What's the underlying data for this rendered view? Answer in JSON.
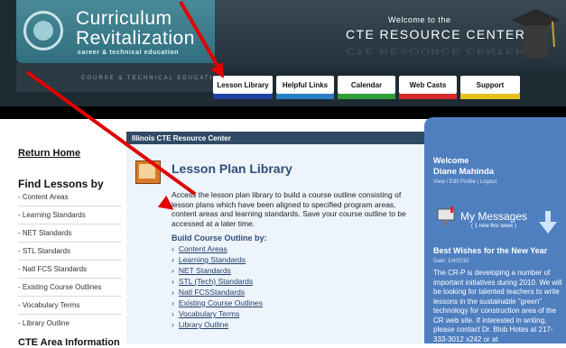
{
  "header": {
    "brand_line1": "Curriculum",
    "brand_line2": "Revitalization",
    "brand_sub": "career & technical education",
    "brand_faint": "COURSE & TECHNICAL EDUCATI",
    "welcome_line1": "Welcome to the",
    "welcome_line2": "CTE RESOURCE CENTER",
    "welcome_reflect": "CTE RESOURCE CENTER"
  },
  "nav": {
    "tabs": [
      {
        "label": "Lesson Library",
        "color": "#1f3fa0"
      },
      {
        "label": "Helpful Links",
        "color": "#2a7fc2"
      },
      {
        "label": "Calendar",
        "color": "#2e9d3a"
      },
      {
        "label": "Web Casts",
        "color": "#d72a2a"
      },
      {
        "label": "Support",
        "color": "#e8c21a"
      }
    ]
  },
  "sidebar": {
    "return_home": "Return Home",
    "find_heading": "Find Lessons by",
    "items": [
      "- Content Areas",
      "- Learning Standards",
      "- NET Standards",
      "- STL Standards",
      "- Natl FCS Standards",
      "- Existing Course Outlines",
      "- Vocabulary Terms",
      "- Library Outline"
    ],
    "cte_area": "CTE Area Information"
  },
  "center": {
    "bar_title": "Illinois CTE Resource Center",
    "title": "Lesson Plan Library",
    "description": "Access the lesson plan library to build a course outline consisting of lesson plans which have been aligned to specified program areas, content areas and learning standards. Save your course outline to be accessed at a later time.",
    "build_heading": "Build Course Outline by:",
    "links": [
      "Content Areas",
      "Learning Standards",
      "NET Standards",
      "STL (Tech) Standards",
      "Natl FCSStandards",
      "Existing Course Outlines",
      "Vocabulary Terms",
      "Library Outline"
    ]
  },
  "right": {
    "welcome": "Welcome",
    "user_name": "Diane Mahinda",
    "profile_links": "View / Edit Profile  |  Logout",
    "messages_title": "My Messages",
    "messages_count": "( 1 new this week )",
    "news_title": "Best Wishes for the New Year",
    "news_date": "Date: 1/4/2010",
    "news_body": "The CR-P is developing a number of important initiatives during 2010. We will be looking for talented teachers to write lessons in the sustainable \"green\" technology for construction area of the CR web site. If interested in writing, please contact Dr. Blob Hotes at 217-333-3012 x242 or at"
  },
  "colors": {
    "accent_blue": "#4f7fbf",
    "header_dark": "#1f2b33",
    "arrow_red": "#e10000"
  }
}
